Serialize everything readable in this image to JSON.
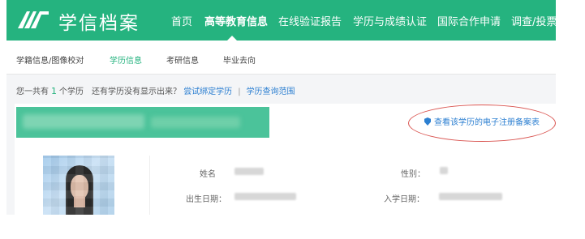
{
  "brand": {
    "name": "学信档案"
  },
  "nav": {
    "items": [
      {
        "label": "首页"
      },
      {
        "label": "高等教育信息",
        "active": true
      },
      {
        "label": "在线验证报告"
      },
      {
        "label": "学历与成绩认证"
      },
      {
        "label": "国际合作申请"
      },
      {
        "label": "调查/投票"
      }
    ]
  },
  "subnav": {
    "items": [
      {
        "label": "学籍信息/图像校对"
      },
      {
        "label": "学历信息",
        "active": true
      },
      {
        "label": "考研信息"
      },
      {
        "label": "毕业去向"
      }
    ]
  },
  "summary": {
    "prefix": "您一共有",
    "count": "1",
    "unit": "个学历",
    "question": "还有学历没有显示出来？",
    "bind_link": "尝试绑定学历",
    "separator": "|",
    "scope_link": "学历查询范围"
  },
  "record": {
    "filing_link": "查看该学历的电子注册备案表",
    "labels": {
      "name": "姓名",
      "gender": "性别：",
      "birth": "出生日期：",
      "enroll": "入学日期："
    }
  },
  "colors": {
    "brand_green": "#25b37f",
    "link_blue": "#2c7fd1",
    "annotation_red": "#d9534f"
  }
}
